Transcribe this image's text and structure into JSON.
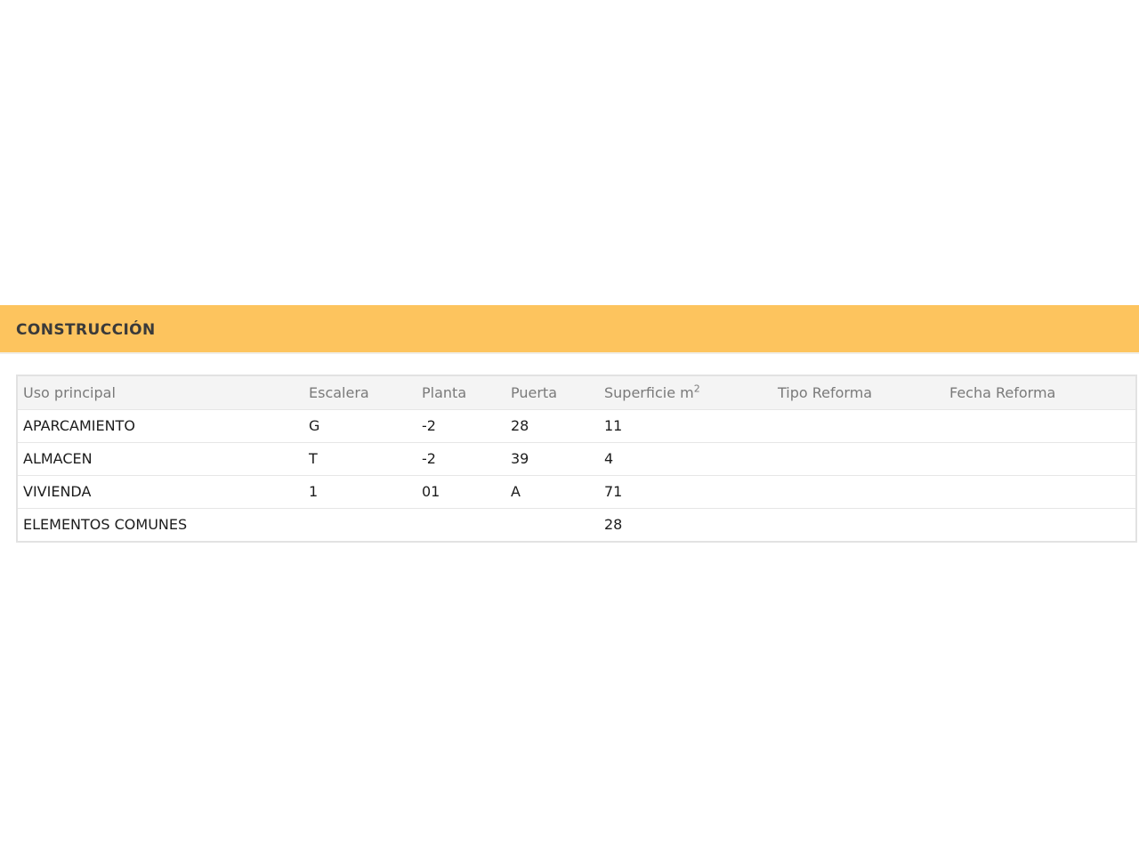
{
  "section": {
    "title": "CONSTRUCCIÓN"
  },
  "table": {
    "headers": {
      "uso": "Uso principal",
      "escalera": "Escalera",
      "planta": "Planta",
      "puerta": "Puerta",
      "superficie": "Superficie m",
      "superficie_sup": "2",
      "tipo_reforma": "Tipo Reforma",
      "fecha_reforma": "Fecha Reforma"
    },
    "rows": [
      {
        "uso": "APARCAMIENTO",
        "escalera": "G",
        "planta": "-2",
        "puerta": "28",
        "superficie": "11",
        "tipo_reforma": "",
        "fecha_reforma": ""
      },
      {
        "uso": "ALMACEN",
        "escalera": "T",
        "planta": "-2",
        "puerta": "39",
        "superficie": "4",
        "tipo_reforma": "",
        "fecha_reforma": ""
      },
      {
        "uso": "VIVIENDA",
        "escalera": "1",
        "planta": "01",
        "puerta": "A",
        "superficie": "71",
        "tipo_reforma": "",
        "fecha_reforma": ""
      },
      {
        "uso": "ELEMENTOS COMUNES",
        "escalera": "",
        "planta": "",
        "puerta": "",
        "superficie": "28",
        "tipo_reforma": "",
        "fecha_reforma": ""
      }
    ]
  },
  "colors": {
    "header_band": "#fdc45e",
    "table_head_bg": "#f4f4f4"
  }
}
